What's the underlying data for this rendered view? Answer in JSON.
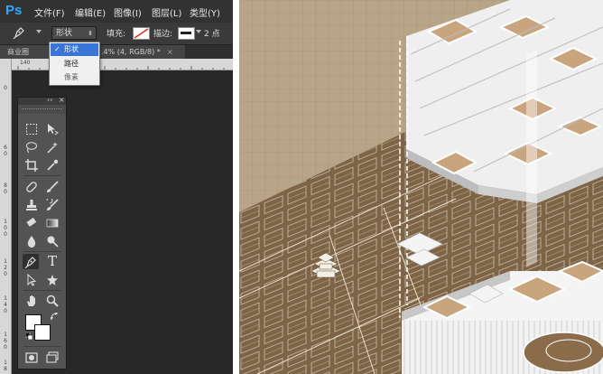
{
  "app": {
    "logo": "Ps"
  },
  "menu": [
    "文件(F)",
    "编辑(E)",
    "图像(I)",
    "图层(L)",
    "类型(Y)"
  ],
  "options_bar": {
    "mode_value": "形状",
    "fill_label": "填充:",
    "stroke_label": "描边:",
    "stroke_width": "2 点"
  },
  "mode_dropdown": {
    "items": [
      {
        "label": "形状",
        "checked": "✓"
      },
      {
        "label": "路径"
      },
      {
        "label": "像素"
      }
    ]
  },
  "document_tab": {
    "title": "商业圈",
    "info": ".4% (4, RGB/8) *",
    "close": "×"
  },
  "ruler": {
    "h_label": "140",
    "v_labels": [
      "0",
      "6",
      "0",
      "8",
      "0",
      "1",
      "0",
      "0",
      "1",
      "2",
      "0",
      "1",
      "4",
      "0",
      "1",
      "6",
      "0",
      "1",
      "8"
    ]
  },
  "toolbox": {
    "collapse": "‹‹",
    "close": "×",
    "type_tool": "T"
  },
  "colors": {
    "accent": "#3875d7",
    "ps_blue": "#31a8ff",
    "panel_bg": "#282828",
    "scene_brown": "#7e6447",
    "scene_tan": "#b8a486"
  }
}
